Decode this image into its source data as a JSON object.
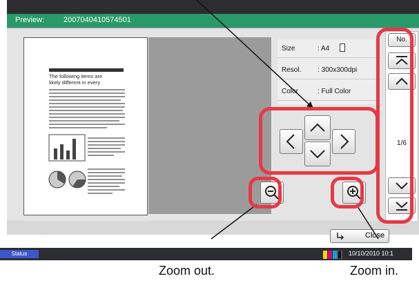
{
  "header": {
    "label": "Preview:",
    "value": "2007040410574501"
  },
  "document_preview": {
    "heading": "The following items are likely different in every",
    "page_indicator": "1/6"
  },
  "properties": [
    {
      "key": "Size",
      "value": ": A4"
    },
    {
      "key": "Resol.",
      "value": ": 300x300dpi"
    },
    {
      "key": "Color",
      "value": ": Full Color"
    }
  ],
  "sidebar": {
    "no_label": "No.",
    "page_indicator": "1/6"
  },
  "footer": {
    "close_label": "Close"
  },
  "status_bar": {
    "status_label": "Status",
    "datetime": "10/10/2010 10:1"
  },
  "annotations": {
    "zoom_out": "Zoom out.",
    "zoom_in": "Zoom in."
  },
  "colors": {
    "accent": "#2a9a6a",
    "highlight": "#e63946",
    "status_button": "#3d56c8"
  }
}
